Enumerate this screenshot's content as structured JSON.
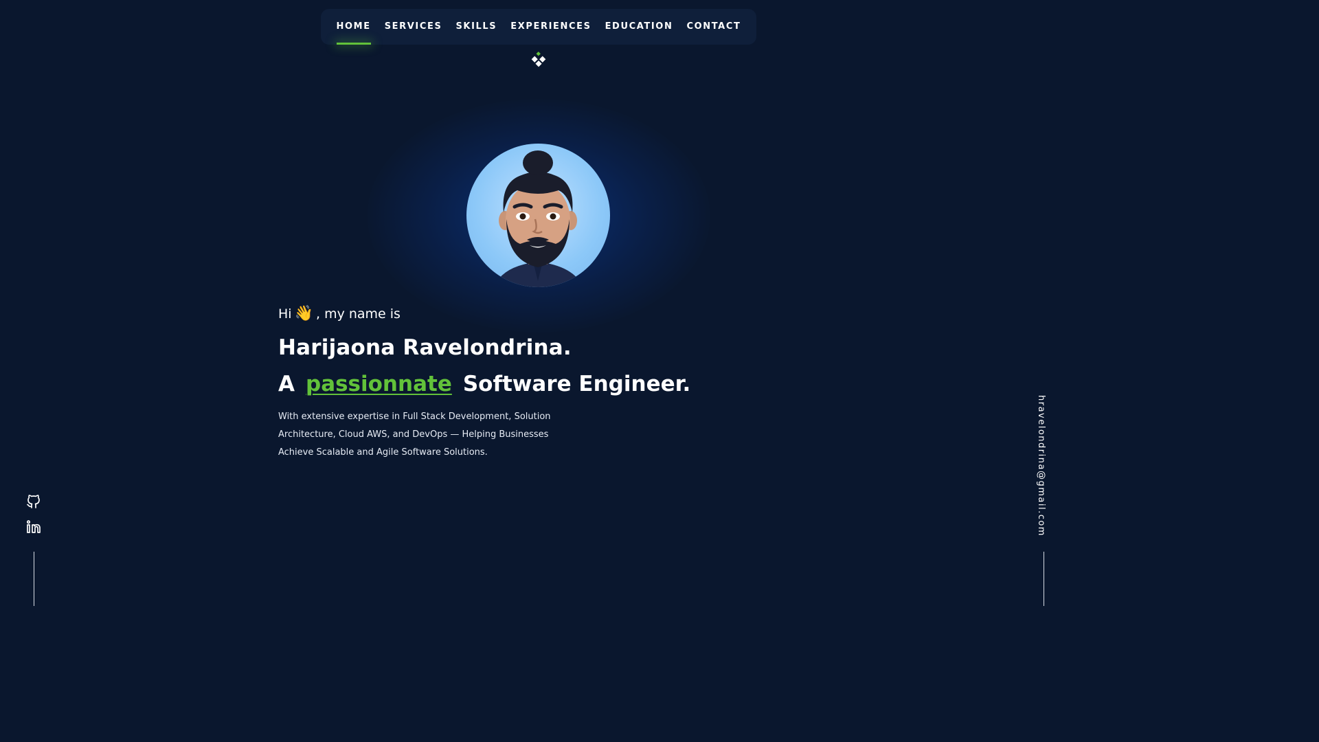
{
  "nav": {
    "items": [
      {
        "label": "HOME",
        "active": true
      },
      {
        "label": "SERVICES",
        "active": false
      },
      {
        "label": "SKILLS",
        "active": false
      },
      {
        "label": "EXPERIENCES",
        "active": false
      },
      {
        "label": "EDUCATION",
        "active": false
      },
      {
        "label": "CONTACT",
        "active": false
      }
    ]
  },
  "logo": {
    "icon": "diamond-cluster-icon"
  },
  "avatar": {
    "icon": "memoji-avatar"
  },
  "hero": {
    "greeting_prefix": "Hi",
    "wave": "👋",
    "greeting_suffix": ", my name is",
    "name": "Harijaona Ravelondrina.",
    "tagline_prefix": "A",
    "tagline_accent": "passionnate",
    "tagline_suffix": "Software Engineer.",
    "description": "With extensive expertise in Full Stack Development, Solution Architecture, Cloud AWS, and DevOps — Helping Businesses Achieve Scalable and Agile Software Solutions."
  },
  "social": [
    {
      "icon": "github-icon"
    },
    {
      "icon": "linkedin-icon"
    }
  ],
  "email": "hravelondrina@gmail.com",
  "colors": {
    "background": "#0a172e",
    "nav_background": "#0f1f3a",
    "accent": "#62c23a",
    "text": "#ffffff"
  }
}
